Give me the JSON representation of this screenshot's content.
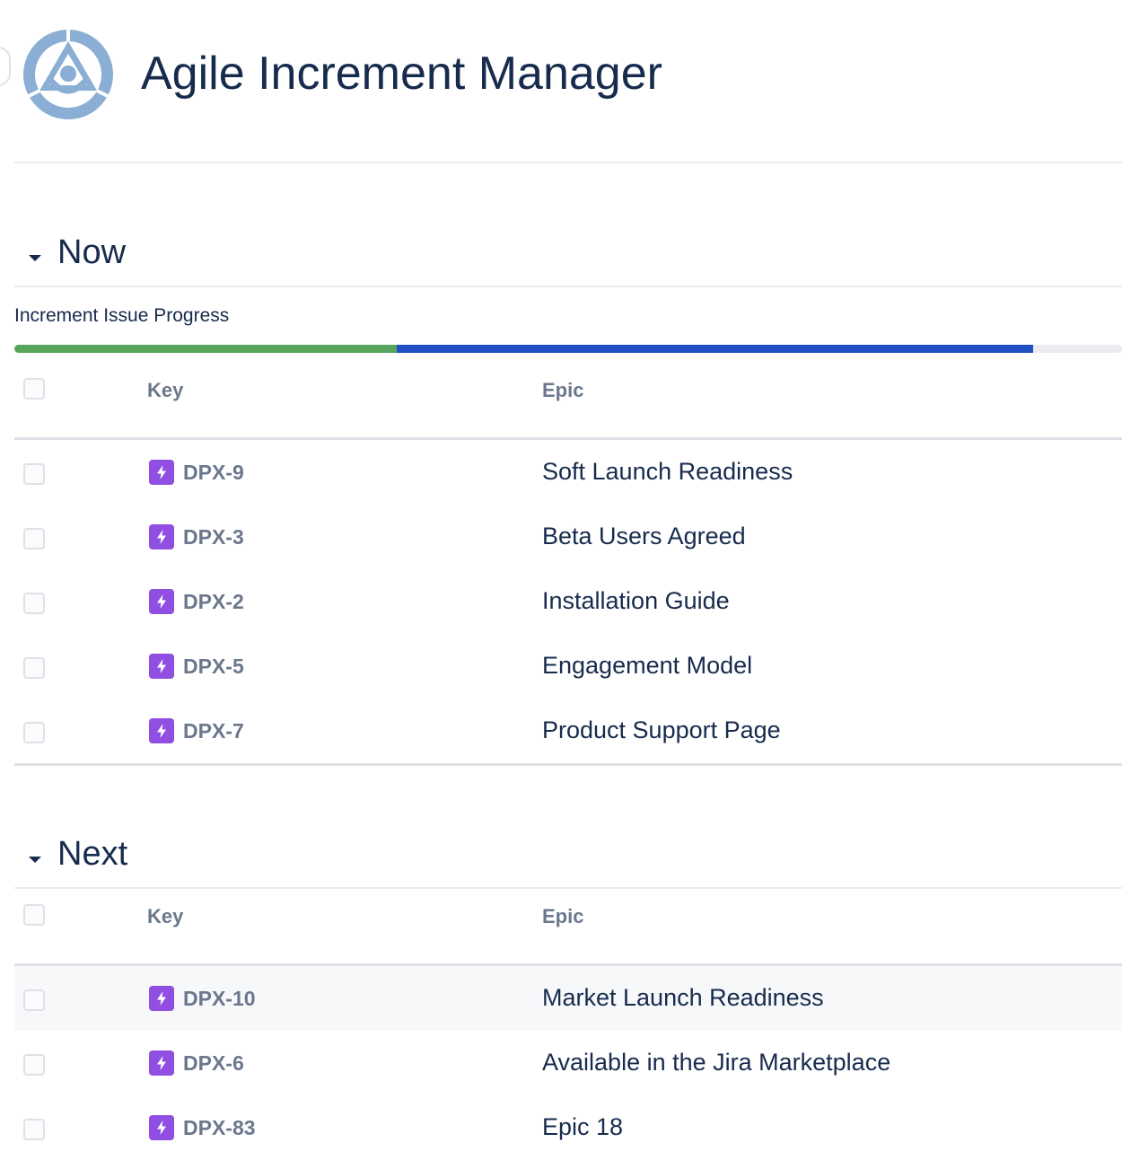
{
  "app": {
    "title": "Agile Increment Manager",
    "logo_icon": "target-triangle-logo-icon"
  },
  "colors": {
    "done": "#57a55a",
    "in_progress": "#2150c4",
    "todo": "#ebecf0",
    "epic": "#904ee2"
  },
  "sections": {
    "now": {
      "title": "Now",
      "progress_label": "Increment Issue Progress",
      "progress": {
        "done_fraction": 0.345,
        "in_progress_fraction": 0.575,
        "todo_fraction": 0.08
      },
      "columns": {
        "key": "Key",
        "epic": "Epic"
      },
      "rows": [
        {
          "key": "DPX-9",
          "epic": "Soft Launch Readiness"
        },
        {
          "key": "DPX-3",
          "epic": "Beta Users Agreed"
        },
        {
          "key": "DPX-2",
          "epic": "Installation Guide"
        },
        {
          "key": "DPX-5",
          "epic": "Engagement Model"
        },
        {
          "key": "DPX-7",
          "epic": "Product Support Page"
        }
      ]
    },
    "next": {
      "title": "Next",
      "columns": {
        "key": "Key",
        "epic": "Epic"
      },
      "rows": [
        {
          "key": "DPX-10",
          "epic": "Market Launch Readiness"
        },
        {
          "key": "DPX-6",
          "epic": "Available in the Jira Marketplace"
        },
        {
          "key": "DPX-83",
          "epic": "Epic 18"
        }
      ]
    }
  }
}
